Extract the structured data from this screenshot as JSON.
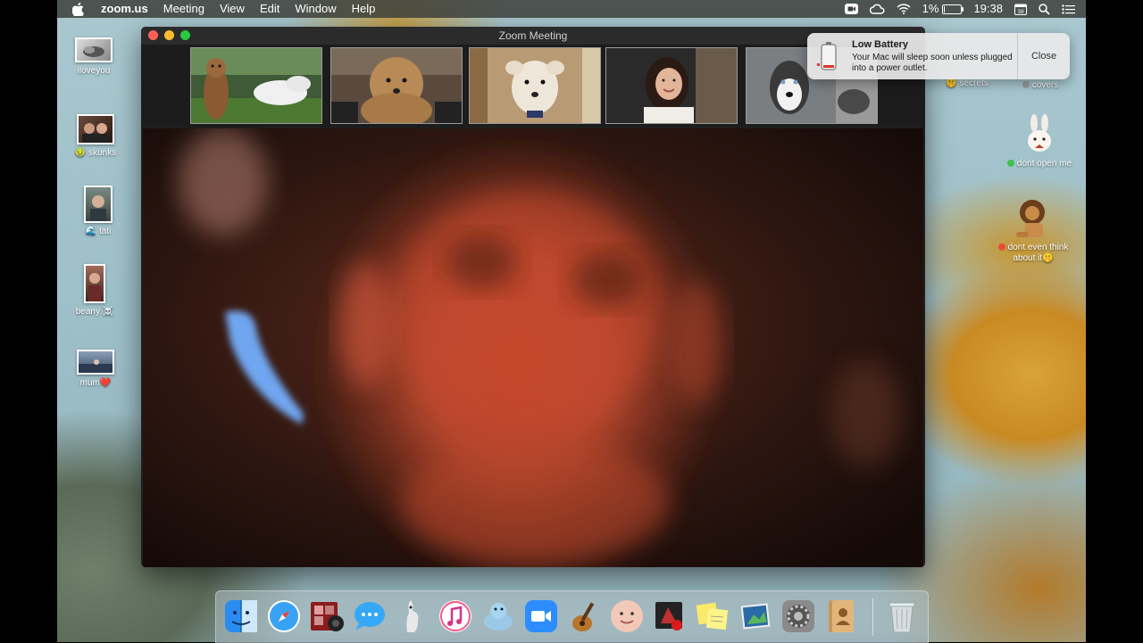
{
  "menubar": {
    "app_name": "zoom.us",
    "menus": [
      "Meeting",
      "View",
      "Edit",
      "Window",
      "Help"
    ],
    "battery_percent": "1%",
    "clock": "19:38",
    "icons": [
      "apple-icon",
      "zoom-status-icon",
      "creative-cloud-icon",
      "wifi-icon",
      "battery-icon",
      "calendar-icon",
      "spotlight-search-icon",
      "notification-center-icon"
    ],
    "calendar_day": "38"
  },
  "desktop_icons": [
    {
      "label": "iloveyou"
    },
    {
      "label": "skunks",
      "emoji": "🤢"
    },
    {
      "label": "tati",
      "emoji": "🌊"
    },
    {
      "label": "beany",
      "emoji": "☠️"
    },
    {
      "label": "mum",
      "emoji": "❤️"
    },
    {
      "label": "secrets",
      "emoji": "🤫"
    },
    {
      "label": "covers"
    },
    {
      "label": "dont open me"
    },
    {
      "label": "dont even think about it",
      "emoji": "🤫"
    }
  ],
  "zoom_window": {
    "title": "Zoom Meeting",
    "participants": [
      "dog-in-garden",
      "fluffy-dog",
      "white-dog",
      "smiling-woman",
      "husky"
    ]
  },
  "notification": {
    "title": "Low Battery",
    "body": "Your Mac will sleep soon unless plugged into a power outlet.",
    "close_label": "Close"
  },
  "dock": {
    "apps": [
      "finder",
      "safari",
      "photo-booth",
      "messages",
      "preview",
      "itunes",
      "sequel-pro",
      "zoom",
      "garageband",
      "memoji",
      "photo-app",
      "stickies",
      "preview-2",
      "system-preferences",
      "contacts",
      "trash"
    ]
  },
  "colors": {
    "accent_red": "#fe5f57",
    "accent_yellow": "#febb2e",
    "accent_green": "#2bc840",
    "zoom_blue": "#2d8cff"
  }
}
